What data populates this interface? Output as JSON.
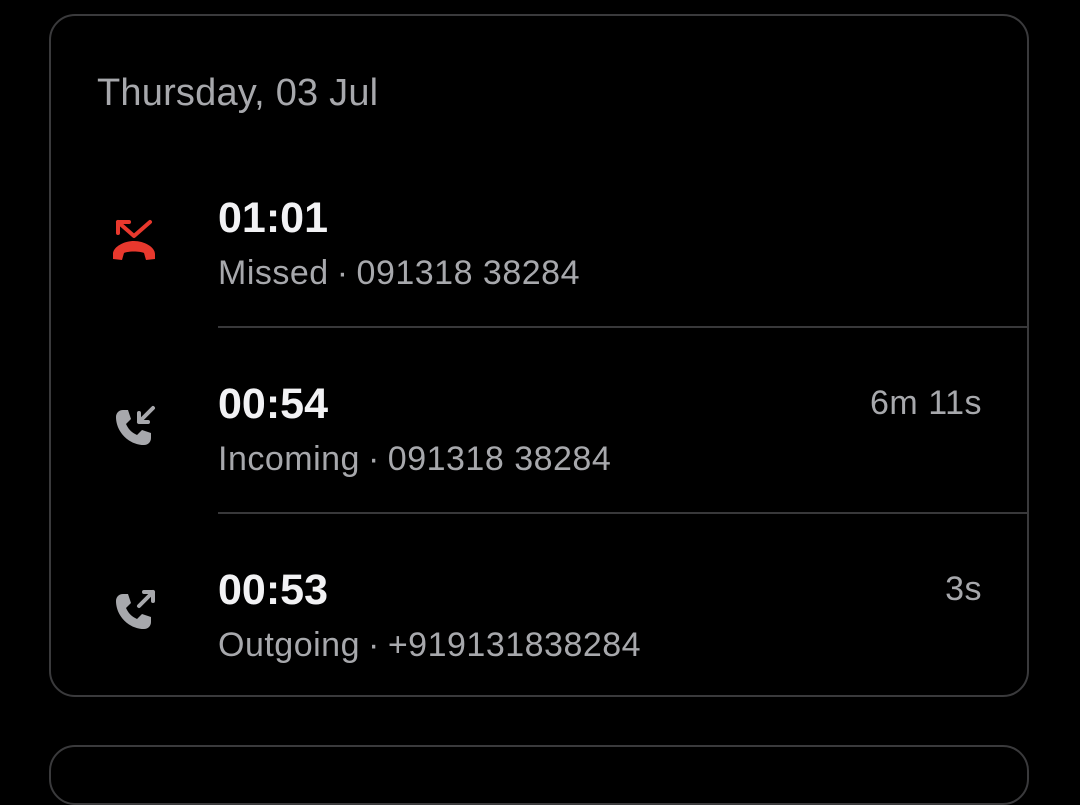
{
  "date_header": "Thursday, 03 Jul",
  "calls": [
    {
      "time": "01:01",
      "type": "Missed",
      "number": "091318 38284",
      "duration": "",
      "icon": "missed-call-icon",
      "icon_color": "#e8382d"
    },
    {
      "time": "00:54",
      "type": "Incoming",
      "number": "091318 38284",
      "duration": "6m 11s",
      "icon": "incoming-call-icon",
      "icon_color": "#a7a8ac"
    },
    {
      "time": "00:53",
      "type": "Outgoing",
      "number": "+919131838284",
      "duration": "3s",
      "icon": "outgoing-call-icon",
      "icon_color": "#a7a8ac"
    }
  ],
  "separator": "·",
  "colors": {
    "background": "#000000",
    "card_border": "#3a3a3c",
    "primary_text": "#f2f2f4",
    "secondary_text": "#a7a8ac",
    "missed": "#e8382d"
  }
}
